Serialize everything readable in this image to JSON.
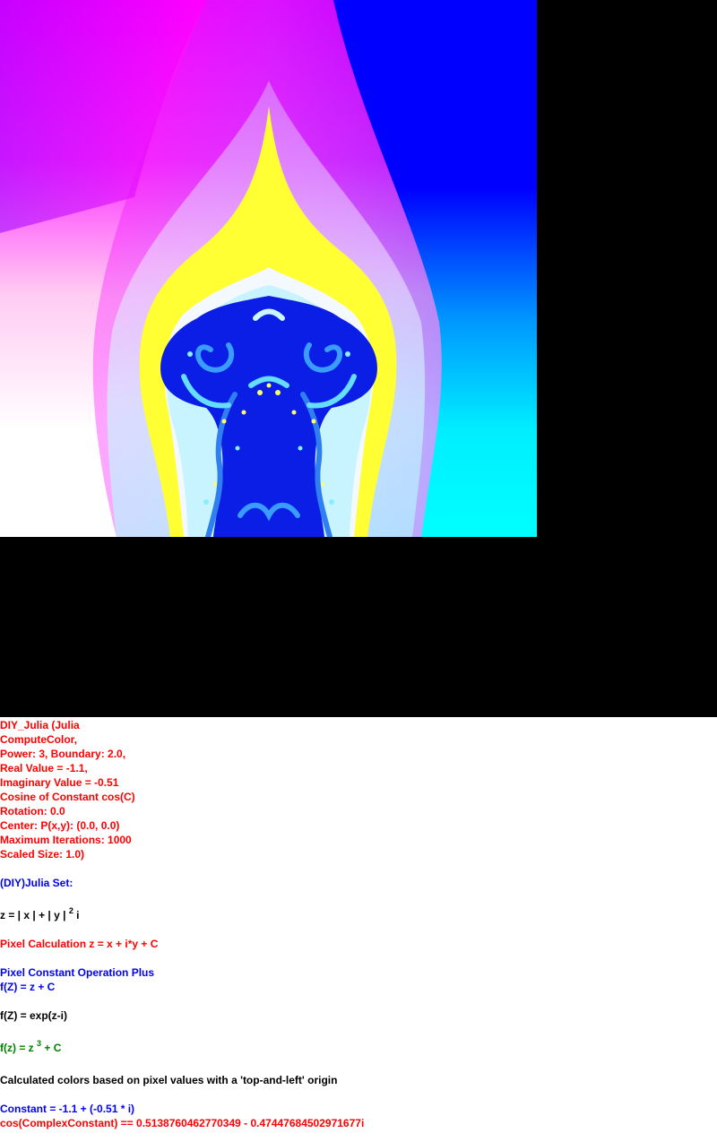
{
  "params": {
    "line1": "DIY_Julia (Julia",
    "line2": "ComputeColor,",
    "line3": "Power: 3, Boundary: 2.0,",
    "line4": "Real Value = -1.1,",
    "line5": "Imaginary Value = -0.51",
    "line6": "Cosine of Constant cos(C)",
    "line7": "Rotation: 0.0",
    "line8": "Center: P(x,y): (0.0, 0.0)",
    "line9": "Maximum Iterations: 1000",
    "line10": "Scaled Size: 1.0)"
  },
  "set_title": "(DIY)Julia Set:",
  "z_formula": {
    "pre": "z = | x | + | y | ",
    "exp": "2",
    "post": " i"
  },
  "pixel_calc": "Pixel Calculation z = x + i*y + C",
  "constant_op": {
    "title": "Pixel Constant Operation Plus",
    "formula": "f(Z) = z + C"
  },
  "exp_formula": "f(Z) = exp(z-i)",
  "iter_formula": {
    "pre": "f(z) = z ",
    "exp": "3",
    "post": " + C"
  },
  "colors_note": "Calculated colors based on pixel values with a 'top-and-left' origin",
  "constant_line": "Constant = -1.1 + (-0.51 * i)",
  "cos_line": "cos(ComplexConstant) == 0.5138760462770349 - 0.47447684502971677i"
}
